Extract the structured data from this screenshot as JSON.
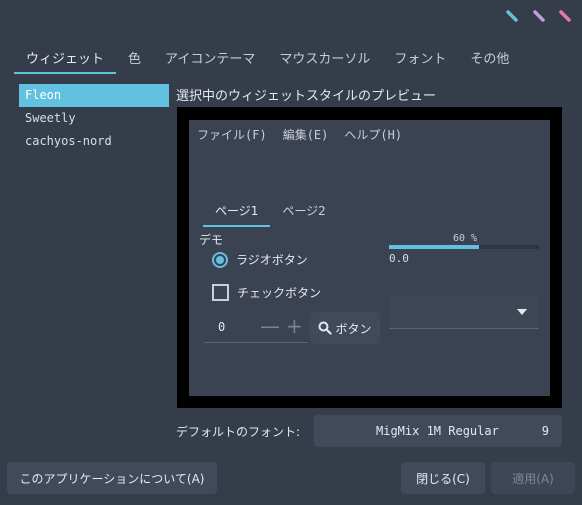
{
  "window_buttons": [
    {
      "name": "minimize",
      "color": "#62c0e0"
    },
    {
      "name": "maximize",
      "color": "#c79be0"
    },
    {
      "name": "close",
      "color": "#e07aa8"
    }
  ],
  "tabs": [
    {
      "label": "ウィジェット",
      "active": true
    },
    {
      "label": "色",
      "active": false
    },
    {
      "label": "アイコンテーマ",
      "active": false
    },
    {
      "label": "マウスカーソル",
      "active": false
    },
    {
      "label": "フォント",
      "active": false
    },
    {
      "label": "その他",
      "active": false
    }
  ],
  "themes": [
    {
      "label": "Fleon",
      "selected": true
    },
    {
      "label": "Sweetly",
      "selected": false
    },
    {
      "label": "cachyos-nord",
      "selected": false
    }
  ],
  "preview": {
    "title": "選択中のウィジェットスタイルのプレビュー",
    "menu": [
      "ファイル(F)",
      "編集(E)",
      "ヘルプ(H)"
    ],
    "tabs": [
      {
        "label": "ページ1",
        "active": true
      },
      {
        "label": "ページ2",
        "active": false
      }
    ],
    "group_label": "デモ",
    "radio_label": "ラジオボタン",
    "check_label": "チェックボタン",
    "spin_value": "0",
    "spin_minus": "—",
    "spin_plus": "+",
    "search_button_label": "ボタン",
    "progress_label": "60 %",
    "progress_fraction": 0.6,
    "scale_value": "0.0"
  },
  "font": {
    "label": "デフォルトのフォント:",
    "name": "MigMix 1M Regular",
    "size": "9"
  },
  "buttons": {
    "about": "このアプリケーションについて(A)",
    "close": "閉じる(C)",
    "apply": "適用(A)"
  },
  "colors": {
    "accent": "#62c0e0",
    "background": "#353c4a"
  }
}
